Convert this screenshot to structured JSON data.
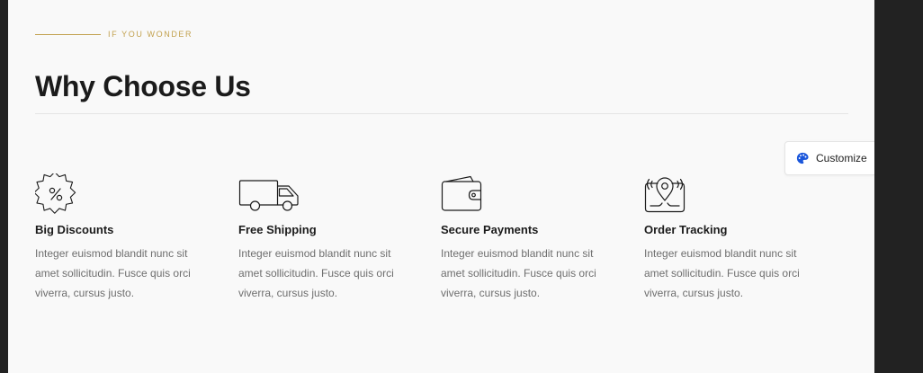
{
  "section": {
    "eyebrow": "IF YOU WONDER",
    "title": "Why Choose Us"
  },
  "features": [
    {
      "icon": "discount-badge-icon",
      "title": "Big Discounts",
      "description": "Integer euismod blandit nunc sit amet sollicitudin. Fusce quis orci viverra, cursus justo."
    },
    {
      "icon": "delivery-truck-icon",
      "title": "Free Shipping",
      "description": "Integer euismod blandit nunc sit amet sollicitudin. Fusce quis orci viverra, cursus justo."
    },
    {
      "icon": "wallet-icon",
      "title": "Secure Payments",
      "description": "Integer euismod blandit nunc sit amet sollicitudin. Fusce quis orci viverra, cursus justo."
    },
    {
      "icon": "location-tracking-icon",
      "title": "Order Tracking",
      "description": "Integer euismod blandit nunc sit amet sollicitudin. Fusce quis orci viverra, cursus justo."
    }
  ],
  "customize_button": {
    "label": "Customize",
    "icon": "palette-icon"
  },
  "colors": {
    "accent": "#c2a14e",
    "heading": "#1b1b1b",
    "body_text": "#6e6e6e",
    "page_background": "#f9f9f9",
    "outer_background": "#222222",
    "palette_icon": "#1a56db"
  }
}
